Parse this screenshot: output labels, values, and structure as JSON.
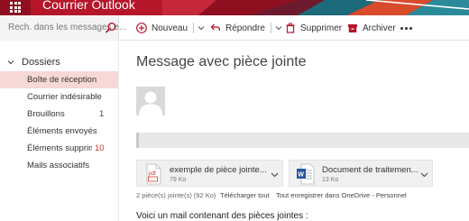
{
  "header": {
    "app_title": "Courrier Outlook",
    "brand_color": "#b5162a"
  },
  "search": {
    "placeholder": "Rech. dans les messages e..."
  },
  "toolbar": {
    "new_label": "Nouveau",
    "reply_label": "Répondre",
    "delete_label": "Supprimer",
    "archive_label": "Archiver",
    "more_icon": "ellipsis-icon"
  },
  "folders": {
    "heading": "Dossiers",
    "items": [
      {
        "label": "Boîte de réception",
        "count": "",
        "selected": true
      },
      {
        "label": "Courrier indésirable",
        "count": ""
      },
      {
        "label": "Brouillons",
        "count": "1"
      },
      {
        "label": "Éléments envoyés",
        "count": ""
      },
      {
        "label": "Éléments supprimé",
        "count": "10"
      },
      {
        "label": "Mails associatifs",
        "count": ""
      }
    ],
    "selected_color": "#f6d8d6",
    "count_accent": "#c0392b"
  },
  "message": {
    "subject": "Message avec pièce jointe",
    "body": "Voici un mail contenant des pièces jointes :"
  },
  "attachments": {
    "items": [
      {
        "name": "exemple de pièce jointe...",
        "size": "79 Ko",
        "icon": "pdf-file-icon"
      },
      {
        "name": "Document de traitemen...",
        "size": "13 Ko",
        "icon": "word-file-icon"
      }
    ],
    "summary": "2 pièce(s) jointe(s) (92 Ko)",
    "download_all": "Télécharger tout",
    "save_all": "Tout enregistrer dans OneDrive - Personnel"
  }
}
